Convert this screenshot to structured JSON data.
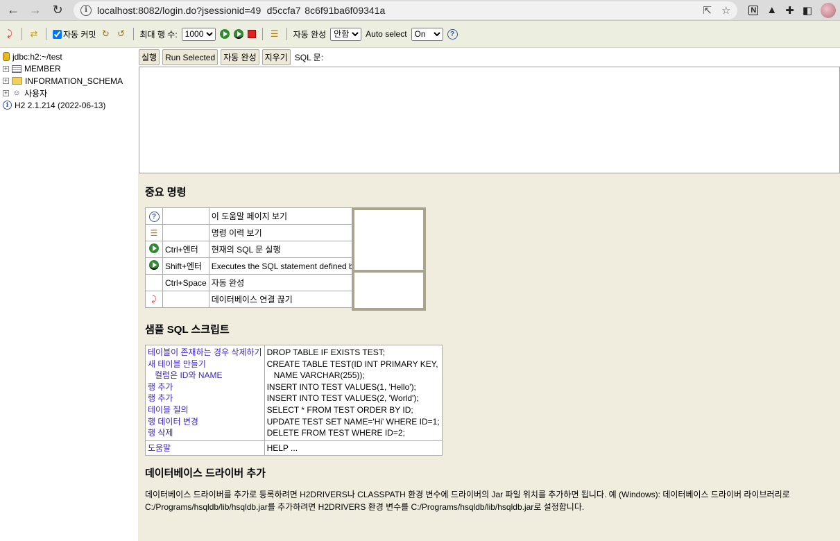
{
  "browser": {
    "url": "localhost:8082/login.do?jsessionid=49   d5ccfa7  8c6f91ba6f09341a",
    "icons": [
      "back-arrow-icon",
      "forward-arrow-icon",
      "reload-icon",
      "site-info-icon",
      "share-icon",
      "star-icon",
      "notion-icon",
      "extension-icon",
      "puzzle-icon",
      "sidebar-icon",
      "profile-avatar"
    ]
  },
  "toolbar": {
    "autocommit_label": "자동 커밋",
    "max_rows_label": "최대 행 수:",
    "max_rows_value": "1000",
    "autocomplete_label": "자동 완성",
    "autocomplete_value": "안함",
    "autoselect_label": "Auto select",
    "autoselect_value": "On"
  },
  "sidebar": {
    "connection": "jdbc:h2:~/test",
    "items": [
      {
        "label": "MEMBER"
      },
      {
        "label": "INFORMATION_SCHEMA"
      },
      {
        "label": "사용자"
      }
    ],
    "version": "H2 2.1.214 (2022-06-13)"
  },
  "sqlbar": {
    "run": "실행",
    "run_selected": "Run Selected",
    "autocomplete": "자동 완성",
    "clear": "지우기",
    "sql_label": "SQL 문:"
  },
  "help": {
    "important_title": "중요 명령",
    "commands": [
      {
        "icon": "help-icon",
        "key": "",
        "desc": "이 도움말 페이지 보기"
      },
      {
        "icon": "history-icon",
        "key": "",
        "desc": "명령 이력 보기"
      },
      {
        "icon": "run-icon",
        "key": "Ctrl+엔터",
        "desc": "현재의 SQL 문 실행"
      },
      {
        "icon": "run-selected-icon",
        "key": "Shift+엔터",
        "desc": "Executes the SQL statement defined b"
      },
      {
        "icon": "",
        "key": "Ctrl+Space",
        "desc": "자동 완성"
      },
      {
        "icon": "disconnect-icon",
        "key": "",
        "desc": "데이터베이스 연결 끊기"
      }
    ],
    "sample_title": "샘플 SQL 스크립트",
    "samples": [
      {
        "label": "테이블이 존재하는 경우 삭제하기",
        "sql": "DROP TABLE IF EXISTS TEST;"
      },
      {
        "label": "새 테이블 만들기",
        "sql": "CREATE TABLE TEST(ID INT PRIMARY KEY,"
      },
      {
        "label": "컬럼은 ID와 NAME",
        "sql": "NAME VARCHAR(255));"
      },
      {
        "label": "행 추가",
        "sql": "INSERT INTO TEST VALUES(1, 'Hello');"
      },
      {
        "label": "행 추가",
        "sql": "INSERT INTO TEST VALUES(2, 'World');"
      },
      {
        "label": "테이블 질의",
        "sql": "SELECT * FROM TEST ORDER BY ID;"
      },
      {
        "label": "행 데이터 변경",
        "sql": "UPDATE TEST SET NAME='Hi' WHERE ID=1;"
      },
      {
        "label": "행 삭제",
        "sql": "DELETE FROM TEST WHERE ID=2;"
      }
    ],
    "help_label": "도움말",
    "help_sql": "HELP ...",
    "driver_title": "데이터베이스 드라이버 추가",
    "driver_text_1": "데이터베이스 드라이버를 추가로 등록하려면 H2DRIVERS나 CLASSPATH 환경 변수에 드라이버의 Jar 파일 위치를 추가하면 됩니다. 예 (Windows): 데이터베이스 드라이버 라이브러리로",
    "driver_text_2": "C:/Programs/hsqldb/lib/hsqldb.jar를 추가하려면 H2DRIVERS 환경 변수를 C:/Programs/hsqldb/lib/hsqldb.jar로 설정합니다."
  }
}
